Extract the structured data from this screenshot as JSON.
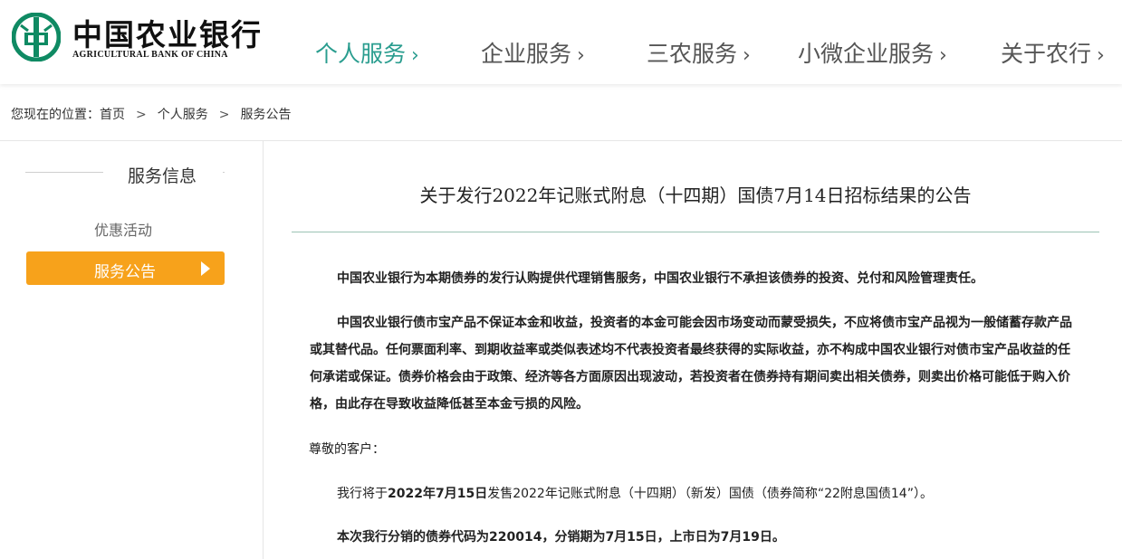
{
  "header": {
    "logo_cn": "中国农业银行",
    "logo_en": "AGRICULTURAL BANK OF CHINA",
    "nav": [
      {
        "label": "个人服务",
        "active": true
      },
      {
        "label": "企业服务",
        "active": false
      },
      {
        "label": "三农服务",
        "active": false
      },
      {
        "label": "小微企业服务",
        "active": false
      },
      {
        "label": "关于农行",
        "active": false
      }
    ],
    "chevron": "›",
    "colors": {
      "accent": "#2a9d8f",
      "logo": "#0f8a63"
    }
  },
  "breadcrumb": {
    "prefix": "您现在的位置：",
    "items": [
      "首页",
      "个人服务",
      "服务公告"
    ],
    "sep": ">"
  },
  "sidebar": {
    "title": "服务信息",
    "items": [
      {
        "label": "优惠活动",
        "active": false
      },
      {
        "label": "服务公告",
        "active": true
      }
    ],
    "active_color": "#f7a21b"
  },
  "article": {
    "title": "关于发行2022年记账式附息（十四期）国债7月14日招标结果的公告",
    "p1": "中国农业银行为本期债券的发行认购提供代理销售服务，中国农业银行不承担该债券的投资、兑付和风险管理责任。",
    "p2": "中国农业银行债市宝产品不保证本金和收益，投资者的本金可能会因市场变动而蒙受损失，不应将债市宝产品视为一般储蓄存款产品或其替代品。任何票面利率、到期收益率或类似表述均不代表投资者最终获得的实际收益，亦不构成中国农业银行对债市宝产品收益的任何承诺或保证。债券价格会由于政策、经济等各方面原因出现波动，若投资者在债券持有期间卖出相关债券，则卖出价格可能低于购入价格，由此存在导致收益降低甚至本金亏损的风险。",
    "salutation": "尊敬的客户：",
    "p3_a": "我行将于",
    "p3_b": "2022年7月15日",
    "p3_c": "发售2022年记账式附息（十四期）（新发）国债（债券简称“22附息国债14”）。",
    "p4": "本次我行分销的债券代码为220014，分销期为7月15日，上市日为7月19日。"
  }
}
